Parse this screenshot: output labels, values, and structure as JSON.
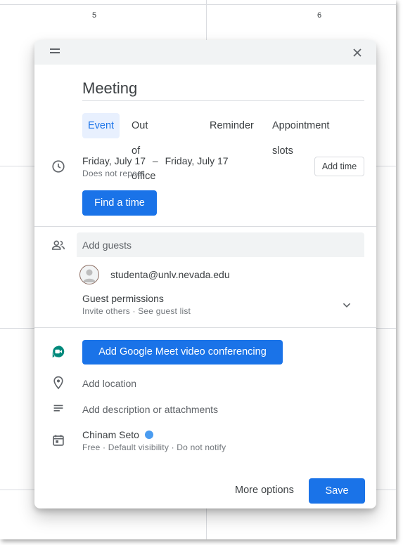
{
  "calendar": {
    "day_numbers": [
      "5",
      "6"
    ]
  },
  "dialog": {
    "title": "Meeting",
    "tabs": [
      {
        "label": "Event"
      },
      {
        "label": "Out of office"
      },
      {
        "label": "Reminder"
      },
      {
        "label": "Appointment slots"
      }
    ],
    "date": {
      "start": "Friday, July 17",
      "separator": "–",
      "end": "Friday, July 17",
      "repeat": "Does not repeat",
      "add_time_label": "Add time",
      "find_time_label": "Find a time"
    },
    "guests": {
      "placeholder": "Add guests",
      "list": [
        {
          "email": "studenta@unlv.nevada.edu"
        }
      ],
      "permissions_title": "Guest permissions",
      "permissions_summary": "Invite others · See guest list"
    },
    "meet_button_label": "Add Google Meet video conferencing",
    "location_placeholder": "Add location",
    "description_placeholder": "Add description or attachments",
    "calendar_owner": {
      "name": "Chinam Seto",
      "color": "#4a9cf0",
      "summary": "Free · Default visibility · Do not notify"
    },
    "footer": {
      "more_options_label": "More options",
      "save_label": "Save"
    }
  },
  "colors": {
    "accent": "#1a73e8",
    "active_tab_bg": "#e8f0fe",
    "meet_icon": "#00897b"
  },
  "icons": [
    "drag-handle-icon",
    "close-icon",
    "clock-icon",
    "people-icon",
    "person-icon",
    "chevron-down-icon",
    "google-meet-icon",
    "location-pin-icon",
    "notes-icon",
    "calendar-icon"
  ]
}
